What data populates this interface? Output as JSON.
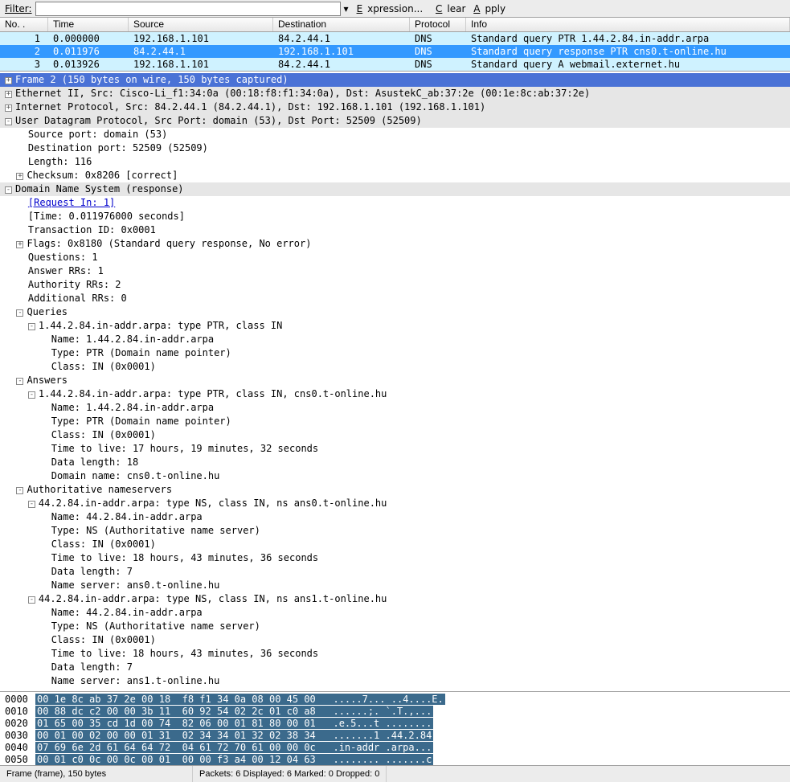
{
  "filter": {
    "label": "Filter:",
    "value": "",
    "expression": "Expression...",
    "clear": "Clear",
    "apply": "Apply"
  },
  "columns": {
    "no": "No. .",
    "time": "Time",
    "source": "Source",
    "destination": "Destination",
    "protocol": "Protocol",
    "info": "Info"
  },
  "packets": [
    {
      "no": "1",
      "time": "0.000000",
      "src": "192.168.1.101",
      "dst": "84.2.44.1",
      "proto": "DNS",
      "info": "Standard query PTR 1.44.2.84.in-addr.arpa"
    },
    {
      "no": "2",
      "time": "0.011976",
      "src": "84.2.44.1",
      "dst": "192.168.1.101",
      "proto": "DNS",
      "info": "Standard query response PTR cns0.t-online.hu"
    },
    {
      "no": "3",
      "time": "0.013926",
      "src": "192.168.1.101",
      "dst": "84.2.44.1",
      "proto": "DNS",
      "info": "Standard query A webmail.externet.hu"
    }
  ],
  "details": {
    "frame": "Frame 2 (150 bytes on wire, 150 bytes captured)",
    "eth": "Ethernet II, Src: Cisco-Li_f1:34:0a (00:18:f8:f1:34:0a), Dst: AsustekC_ab:37:2e (00:1e:8c:ab:37:2e)",
    "ip": "Internet Protocol, Src: 84.2.44.1 (84.2.44.1), Dst: 192.168.1.101 (192.168.1.101)",
    "udp": "User Datagram Protocol, Src Port: domain (53), Dst Port: 52509 (52509)",
    "udp_src": "Source port: domain (53)",
    "udp_dst": "Destination port: 52509 (52509)",
    "udp_len": "Length: 116",
    "udp_csum": "Checksum: 0x8206 [correct]",
    "dns": "Domain Name System (response)",
    "req_in": "[Request In: 1]",
    "dns_time": "[Time: 0.011976000 seconds]",
    "txid": "Transaction ID: 0x0001",
    "flags": "Flags: 0x8180 (Standard query response, No error)",
    "questions": "Questions: 1",
    "ans_rr": "Answer RRs: 1",
    "auth_rr": "Authority RRs: 2",
    "add_rr": "Additional RRs: 0",
    "queries": "Queries",
    "q1": "1.44.2.84.in-addr.arpa: type PTR, class IN",
    "q1_name": "Name: 1.44.2.84.in-addr.arpa",
    "q1_type": "Type: PTR (Domain name pointer)",
    "q1_class": "Class: IN (0x0001)",
    "answers": "Answers",
    "a1": "1.44.2.84.in-addr.arpa: type PTR, class IN, cns0.t-online.hu",
    "a1_name": "Name: 1.44.2.84.in-addr.arpa",
    "a1_type": "Type: PTR (Domain name pointer)",
    "a1_class": "Class: IN (0x0001)",
    "a1_ttl": "Time to live: 17 hours, 19 minutes, 32 seconds",
    "a1_dlen": "Data length: 18",
    "a1_dname": "Domain name: cns0.t-online.hu",
    "auth": "Authoritative nameservers",
    "ns1": "44.2.84.in-addr.arpa: type NS, class IN, ns ans0.t-online.hu",
    "ns1_name": "Name: 44.2.84.in-addr.arpa",
    "ns1_type": "Type: NS (Authoritative name server)",
    "ns1_class": "Class: IN (0x0001)",
    "ns1_ttl": "Time to live: 18 hours, 43 minutes, 36 seconds",
    "ns1_dlen": "Data length: 7",
    "ns1_ns": "Name server: ans0.t-online.hu",
    "ns2": "44.2.84.in-addr.arpa: type NS, class IN, ns ans1.t-online.hu",
    "ns2_name": "Name: 44.2.84.in-addr.arpa",
    "ns2_type": "Type: NS (Authoritative name server)",
    "ns2_class": "Class: IN (0x0001)",
    "ns2_ttl": "Time to live: 18 hours, 43 minutes, 36 seconds",
    "ns2_dlen": "Data length: 7",
    "ns2_ns": "Name server: ans1.t-online.hu"
  },
  "hex": [
    {
      "off": "0000",
      "h": "00 1e 8c ab 37 2e 00 18  f8 f1 34 0a 08 00 45 00",
      "a": ".....7... ..4....E."
    },
    {
      "off": "0010",
      "h": "00 88 dc c2 00 00 3b 11  60 92 54 02 2c 01 c0 a8",
      "a": "......;. `.T.,..."
    },
    {
      "off": "0020",
      "h": "01 65 00 35 cd 1d 00 74  82 06 00 01 81 80 00 01",
      "a": ".e.5...t ........"
    },
    {
      "off": "0030",
      "h": "00 01 00 02 00 00 01 31  02 34 34 01 32 02 38 34",
      "a": ".......1 .44.2.84"
    },
    {
      "off": "0040",
      "h": "07 69 6e 2d 61 64 64 72  04 61 72 70 61 00 00 0c",
      "a": ".in-addr .arpa..."
    },
    {
      "off": "0050",
      "h": "00 01 c0 0c 00 0c 00 01  00 00 f3 a4 00 12 04 63",
      "a": "........ .......c"
    }
  ],
  "status": {
    "left": "Frame (frame), 150 bytes",
    "right": "Packets: 6 Displayed: 6 Marked: 0 Dropped: 0"
  }
}
